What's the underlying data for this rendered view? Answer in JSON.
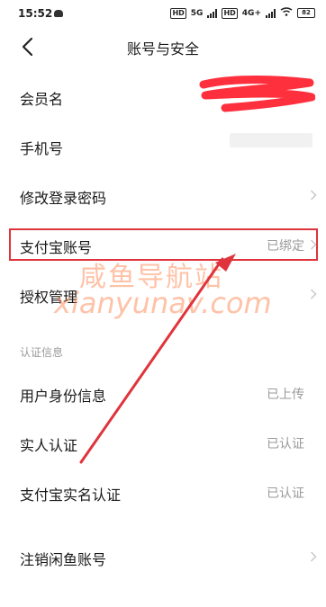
{
  "status_bar": {
    "time": "15:52",
    "hd1": "HD",
    "net1": "5G",
    "hd2": "HD",
    "net2": "4G+",
    "battery": "82"
  },
  "header": {
    "title": "账号与安全"
  },
  "rows": [
    {
      "label": "会员名",
      "value": ""
    },
    {
      "label": "手机号",
      "value": ""
    },
    {
      "label": "修改登录密码",
      "value": ""
    },
    {
      "label": "支付宝账号",
      "value": "已绑定"
    },
    {
      "label": "授权管理",
      "value": ""
    }
  ],
  "section": {
    "title": "认证信息"
  },
  "cert_rows": [
    {
      "label": "用户身份信息",
      "value": "已上传"
    },
    {
      "label": "实人认证",
      "value": "已认证"
    },
    {
      "label": "支付宝实名认证",
      "value": "已认证"
    }
  ],
  "cancel_row": {
    "label": "注销闲鱼账号"
  },
  "watermark": {
    "cn": "咸鱼导航站",
    "en": "xianyunav.com"
  },
  "colors": {
    "highlight": "#e0343c",
    "watermark": "#ff7a3c",
    "muted_text": "#9a9a9a"
  }
}
